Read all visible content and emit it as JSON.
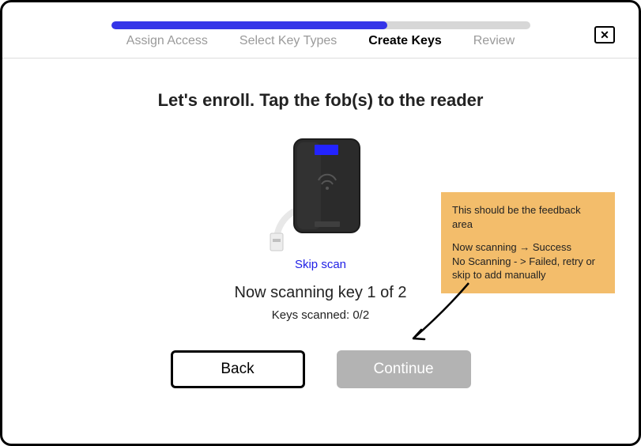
{
  "progress": {
    "percent": 66
  },
  "steps": [
    {
      "label": "Assign Access",
      "active": false
    },
    {
      "label": "Select Key Types",
      "active": false
    },
    {
      "label": "Create Keys",
      "active": true
    },
    {
      "label": "Review",
      "active": false
    }
  ],
  "title": "Let's enroll. Tap the fob(s) to the reader",
  "skip_label": "Skip scan",
  "scan_status": "Now scanning key 1 of 2",
  "scan_count": "Keys scanned: 0/2",
  "buttons": {
    "back": "Back",
    "continue": "Continue"
  },
  "annotation": {
    "line1": "This should be the feedback area",
    "line2": "Now scanning  → Success\nNo Scanning - > Failed, retry or skip to add manually"
  },
  "close_glyph": "✕"
}
